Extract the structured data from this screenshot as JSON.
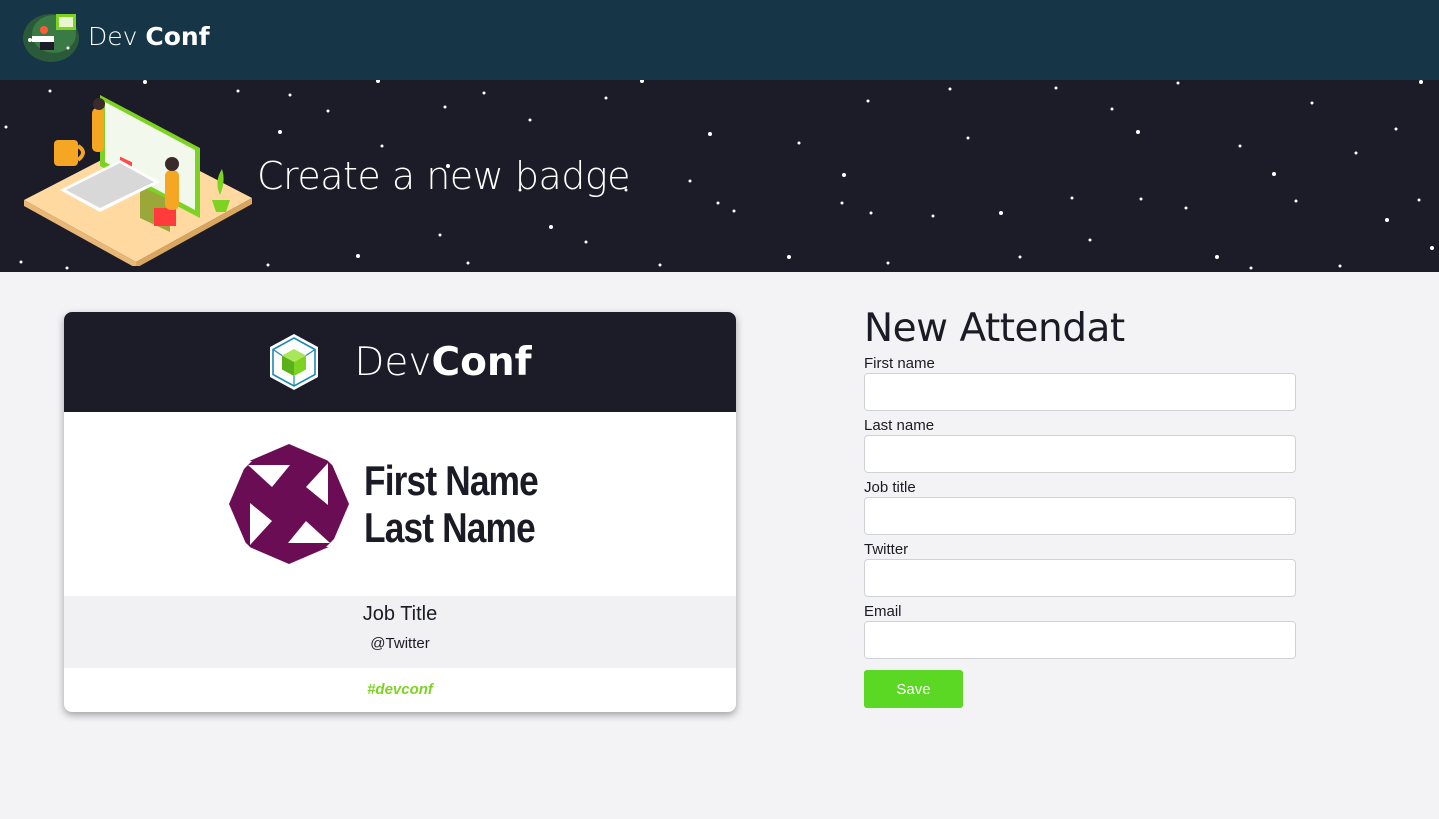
{
  "nav": {
    "brand_light": "Dev",
    "brand_bold": "Conf"
  },
  "hero": {
    "title": "Create a new badge"
  },
  "badge": {
    "header_light": "Dev",
    "header_bold": "Conf",
    "first_name": "First Name",
    "last_name": "Last Name",
    "job_title": "Job Title",
    "twitter": "@Twitter",
    "hashtag": "#devconf"
  },
  "form": {
    "title": "New Attendat",
    "fields": [
      {
        "label": "First name",
        "value": ""
      },
      {
        "label": "Last name",
        "value": ""
      },
      {
        "label": "Job title",
        "value": ""
      },
      {
        "label": "Twitter",
        "value": ""
      },
      {
        "label": "Email",
        "value": ""
      }
    ],
    "save_label": "Save"
  },
  "colors": {
    "navbar": "#163647",
    "hero": "#1c1b28",
    "accent_green": "#5ad823",
    "hashtag_green": "#7dd321",
    "avatar_purple": "#6b0d55"
  }
}
